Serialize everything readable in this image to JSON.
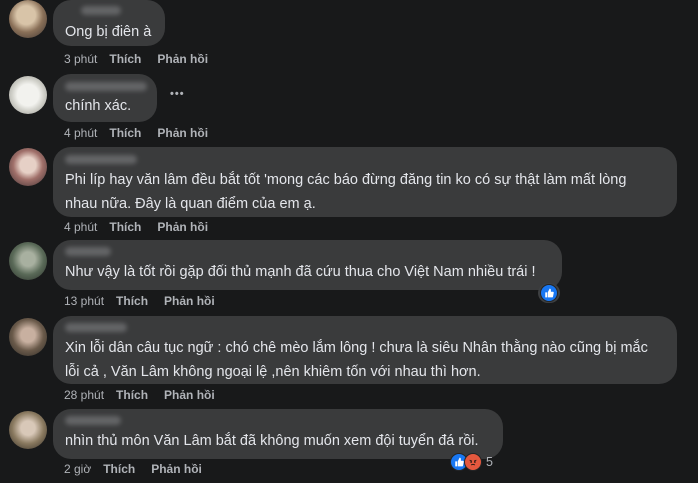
{
  "comments": [
    {
      "text": "Ong bị điên à",
      "time": "3 phút",
      "like": "Thích",
      "reply": "Phản hồi"
    },
    {
      "text": "chính xác.",
      "time": "4 phút",
      "like": "Thích",
      "reply": "Phản hồi",
      "more": "•••"
    },
    {
      "text": "Phi líp hay văn lâm đều bắt tốt 'mong các báo đừng đăng tin ko có sự thật làm mất lòng\nnhau nữa. Đây là quan điểm của em ạ.",
      "time": "4 phút",
      "like": "Thích",
      "reply": "Phản hồi"
    },
    {
      "text": "Như vậy là tốt rồi gặp đối thủ mạnh đã cứu thua cho Việt Nam nhiều trái !",
      "time": "13 phút",
      "like": "Thích",
      "reply": "Phản hồi"
    },
    {
      "text": "Xin lỗi dân câu tục ngữ : chó chê mèo lắm lông ! chưa là siêu Nhân thằng nào cũng bị mắc\nlỗi cả , Văn Lâm không ngoại lệ ,nên khiêm tốn với nhau thì hơn.",
      "time": "28 phút",
      "like": "Thích",
      "reply": "Phản hồi"
    },
    {
      "text": "nhìn thủ môn Văn Lâm bắt đã không muốn xem đội tuyển đá rồi.",
      "time": "2 giờ",
      "like": "Thích",
      "reply": "Phản hồi",
      "reaction_count": "5"
    }
  ],
  "colors": {
    "background": "#18191a",
    "bubble": "#3a3b3c",
    "text": "#e4e6eb",
    "meta": "#b0b3b8",
    "like_blue": "#1877f2"
  },
  "icons": {
    "more": "more-horizontal-icon",
    "like_reaction": "like-reaction-icon",
    "angry_reaction": "angry-reaction-icon"
  }
}
